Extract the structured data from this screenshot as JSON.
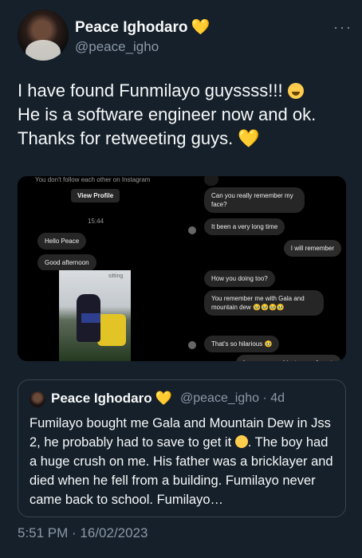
{
  "author": {
    "name": "Peace Ighodaro",
    "heart": "💛",
    "handle": "@peace_igho",
    "more": "···"
  },
  "tweet": {
    "line1": "I have found Funmilayo guyssss!!!",
    "line2": "He is a software engineer now and ok.",
    "line3": "Thanks for retweeting guys.",
    "heart": "💛"
  },
  "media": {
    "panel1": {
      "note": "You don't follow each other on Instagram",
      "button": "View Profile",
      "time": "15:44",
      "msg1": "Hello Peace",
      "msg2": "Good afternoon"
    },
    "panel2": {
      "msg1": "Can you really remember my",
      "msg1b": "face?",
      "msg2": "It been a very long time",
      "msg3": "I will remember"
    },
    "panel3": {
      "sign": "sitting"
    },
    "panel4": {
      "msg1": "How you doing too?",
      "msg2": "You remember me with Gala and",
      "msg2b": "mountain dew 🥹🥹🥹🥹",
      "msg3": "That's so hilarious 🥹",
      "msg4": "I am so sorry. I just never forgot."
    }
  },
  "quote": {
    "name": "Peace Ighodaro",
    "heart": "💛",
    "handle_date": "@peace_igho · 4d",
    "text": "Fumilayo bought me Gala and Mountain Dew in Jss 2, he probably had to save to get it",
    "text2": ". The boy had a huge crush on me. His father was a bricklayer and died when he fell from a building. Fumilayo never came back to school. Fumilayo…"
  },
  "footer": {
    "timestamp": "5:51 PM · 16/02/2023"
  }
}
